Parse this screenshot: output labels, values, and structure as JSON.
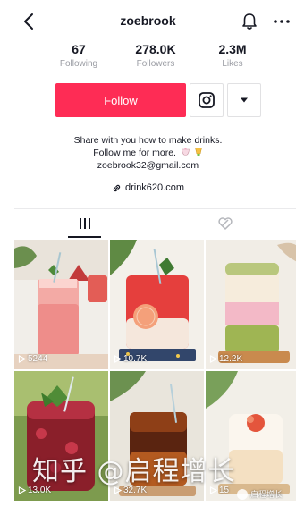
{
  "header": {
    "username": "zoebrook"
  },
  "stats": [
    {
      "value": "67",
      "label": "Following"
    },
    {
      "value": "278.0K",
      "label": "Followers"
    },
    {
      "value": "2.3M",
      "label": "Likes"
    }
  ],
  "actions": {
    "follow_label": "Follow"
  },
  "bio": {
    "line1": "Share with you how to make drinks.",
    "line2": "Follow me for more.",
    "email": "zoebrook32@gmail.com",
    "link": "drink620.com"
  },
  "videos": [
    {
      "views": "5244"
    },
    {
      "views": "10.7K"
    },
    {
      "views": "12.2K"
    },
    {
      "views": "13.0K"
    },
    {
      "views": "32.7K"
    },
    {
      "views": "15"
    }
  ],
  "watermark": {
    "text": "知乎 @启程增长",
    "badge": "启程增长"
  },
  "colors": {
    "accent": "#fe2c55",
    "text": "#161823",
    "muted": "#9a9ca3"
  }
}
